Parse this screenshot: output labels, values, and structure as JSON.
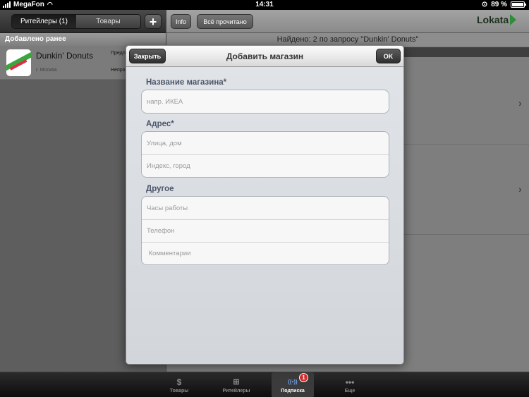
{
  "status_bar": {
    "carrier": "MegaFon",
    "time": "14:31",
    "battery": "89 %",
    "battery_level": 0.89
  },
  "left_panel": {
    "segments": [
      {
        "label": "Ритейлеры (1)",
        "active": true
      },
      {
        "label": "Товары",
        "active": false
      }
    ],
    "add_button_label": "+",
    "section_header": "Добавлено ранее",
    "store": {
      "name": "Dunkin' Donuts",
      "city": "г. Москва",
      "meta1": "Предл",
      "meta2": "Непро"
    }
  },
  "right_panel": {
    "info_label": "Info",
    "read_all_label": "Всё прочитано",
    "logo_text": "Lokata",
    "found_text": "Найдено: 2 по запросу \"Dunkin' Donuts\"",
    "chevron": "›"
  },
  "modal": {
    "title": "Добавить магазин",
    "close_label": "Закрыть",
    "ok_label": "OK",
    "groups": [
      {
        "label": "Название магазина*",
        "fields": [
          {
            "placeholder": "напр. ИКЕА",
            "value": ""
          }
        ]
      },
      {
        "label": "Адрес*",
        "fields": [
          {
            "placeholder": "Улица, дом",
            "value": ""
          },
          {
            "placeholder": "Индекс, город",
            "value": ""
          }
        ]
      },
      {
        "label": "Другое",
        "fields": [
          {
            "placeholder": "Часы работы",
            "value": ""
          },
          {
            "placeholder": "Телефон",
            "value": ""
          },
          {
            "placeholder": " Комментарии",
            "value": ""
          }
        ]
      }
    ]
  },
  "tab_bar": {
    "tabs": [
      {
        "label": "Товары",
        "icon": "dollar-icon",
        "glyph": "$",
        "active": false
      },
      {
        "label": "Ритейлеры",
        "icon": "cart-icon",
        "glyph": "🛒",
        "active": false
      },
      {
        "label": "Подписка",
        "icon": "broadcast-icon",
        "glyph": "((•))",
        "active": true,
        "badge": "1"
      },
      {
        "label": "Еще",
        "icon": "more-icon",
        "glyph": "•••",
        "active": false
      }
    ]
  },
  "colors": {
    "accent_green": "#2f8c3b",
    "badge_red": "#d52b2b",
    "active_tab_icon": "#6fa0e8"
  }
}
